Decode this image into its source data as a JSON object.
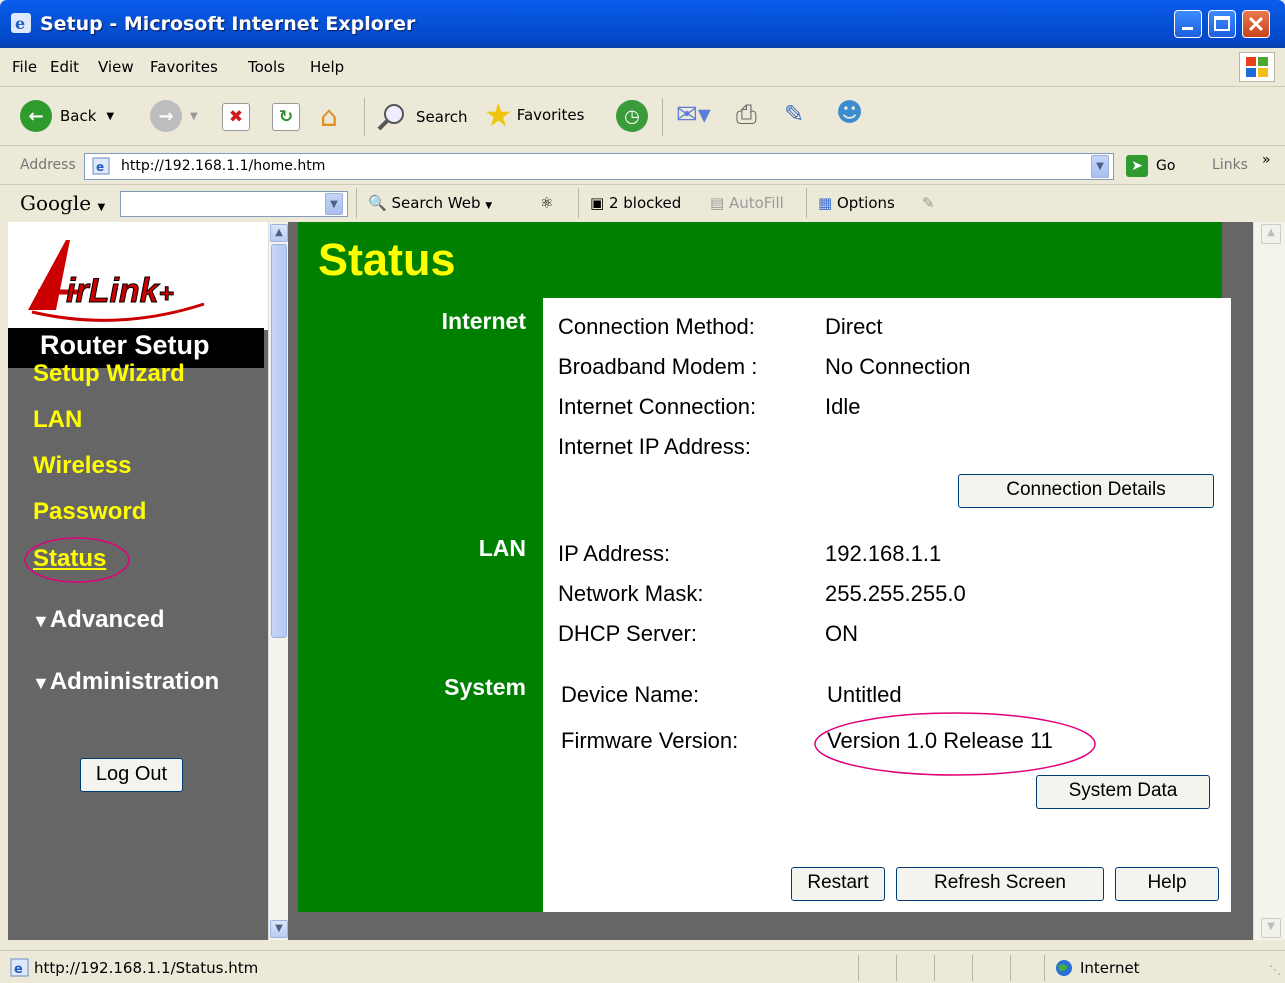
{
  "window": {
    "title": "Setup - Microsoft Internet Explorer"
  },
  "menu": [
    "File",
    "Edit",
    "View",
    "Favorites",
    "Tools",
    "Help"
  ],
  "toolbar": {
    "back_label": "Back",
    "search_label": "Search",
    "favorites_label": "Favorites"
  },
  "address": {
    "label": "Address",
    "url": "http://192.168.1.1/home.htm",
    "go_label": "Go",
    "links_label": "Links"
  },
  "googlebar": {
    "logo": "Google",
    "search_web": "Search Web",
    "blocked": "2 blocked",
    "autofill": "AutoFill",
    "options": "Options"
  },
  "sidebar": {
    "logo_text": "AirLink+",
    "header": "Router Setup",
    "links": [
      "Setup Wizard",
      "LAN",
      "Wireless",
      "Password",
      "Status"
    ],
    "advanced": "Advanced",
    "administration": "Administration",
    "logout": "Log Out"
  },
  "main": {
    "title": "Status",
    "internet": {
      "section": "Internet",
      "rows": [
        {
          "label": "Connection Method:",
          "value": "Direct"
        },
        {
          "label": "Broadband Modem :",
          "value": "No Connection"
        },
        {
          "label": "Internet Connection:",
          "value": "Idle"
        },
        {
          "label": "Internet IP Address:",
          "value": ""
        }
      ],
      "details_button": "Connection Details"
    },
    "lan": {
      "section": "LAN",
      "rows": [
        {
          "label": "IP Address:",
          "value": "192.168.1.1"
        },
        {
          "label": "Network Mask:",
          "value": "255.255.255.0"
        },
        {
          "label": "DHCP Server:",
          "value": "ON"
        }
      ]
    },
    "system": {
      "section": "System",
      "rows": [
        {
          "label": "Device Name:",
          "value": "Untitled"
        },
        {
          "label": "Firmware Version:",
          "value": "Version 1.0 Release 11"
        }
      ],
      "data_button": "System Data"
    },
    "buttons": {
      "restart": "Restart",
      "refresh": "Refresh Screen",
      "help": "Help"
    }
  },
  "statusbar": {
    "url": "http://192.168.1.1/Status.htm",
    "zone": "Internet"
  },
  "colors": {
    "green": "#008000",
    "yellow": "#ffff00",
    "highlight": "#e0007a"
  }
}
